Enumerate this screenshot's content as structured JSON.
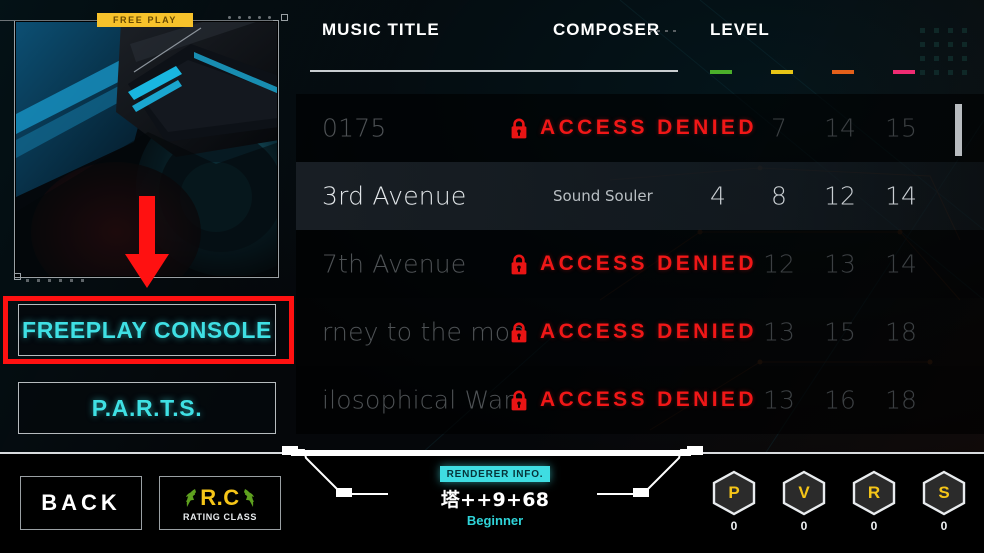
{
  "left_panel": {
    "freeplay_badge": "FREE PLAY",
    "buttons": [
      {
        "label": "FREEPLAY CONSOLE",
        "name": "freeplay-console-button",
        "highlighted": true
      },
      {
        "label": "P.A.R.T.S.",
        "name": "parts-button",
        "highlighted": false
      }
    ]
  },
  "table": {
    "headers": {
      "title": "MUSIC TITLE",
      "composer": "COMPOSER",
      "level": "LEVEL"
    },
    "difficulty_colors": [
      "#4caf2a",
      "#e8c516",
      "#e4601a",
      "#ef2b72"
    ],
    "locked_label": "ACCESS DENIED",
    "rows": [
      {
        "title": "0175",
        "composer": "",
        "locked": true,
        "levels": [
          "",
          "7",
          "14",
          "15"
        ],
        "state": "dim"
      },
      {
        "title": "3rd Avenue",
        "composer": "Sound Souler",
        "locked": false,
        "levels": [
          "4",
          "8",
          "12",
          "14"
        ],
        "state": "selected"
      },
      {
        "title": "7th Avenue",
        "composer": "",
        "locked": true,
        "levels": [
          "",
          "12",
          "13",
          "14"
        ],
        "state": "dim"
      },
      {
        "title": "rney to the moo",
        "composer": "",
        "locked": true,
        "levels": [
          "",
          "13",
          "15",
          "18"
        ],
        "state": "dim2"
      },
      {
        "title": "ilosophical Wan",
        "composer": "",
        "locked": true,
        "levels": [
          "",
          "13",
          "16",
          "18"
        ],
        "state": "dim"
      }
    ]
  },
  "bottom": {
    "back_label": "BACK",
    "rating_class": {
      "main": "R.C",
      "sub": "RATING CLASS"
    },
    "renderer": {
      "badge": "RENDERER INFO.",
      "name": "塔++9+68",
      "rank": "Beginner"
    },
    "stats": [
      {
        "letter": "P",
        "count": "0"
      },
      {
        "letter": "V",
        "count": "0"
      },
      {
        "letter": "R",
        "count": "0"
      },
      {
        "letter": "S",
        "count": "0"
      }
    ]
  },
  "theme": {
    "accent_cyan": "#3fe0e4",
    "accent_yellow": "#f5c518",
    "denied_red": "#f01717",
    "annotation_red": "#ff1111"
  }
}
